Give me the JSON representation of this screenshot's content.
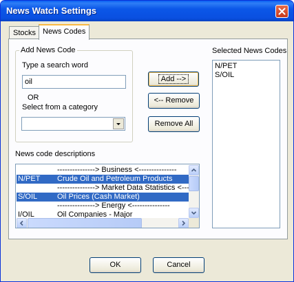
{
  "window": {
    "title": "News Watch Settings"
  },
  "tabs": [
    {
      "label": "Stocks"
    },
    {
      "label": "News Codes"
    }
  ],
  "add_group": {
    "legend": "Add News Code",
    "search_label": "Type a search word",
    "search_value": "oil",
    "or_label": "OR",
    "category_label": "Select from a category",
    "category_value": ""
  },
  "buttons": {
    "add": "Add -->",
    "remove": "<-- Remove",
    "remove_all": "Remove All",
    "ok": "OK",
    "cancel": "Cancel"
  },
  "descriptions": {
    "label": "News code descriptions",
    "rows": [
      {
        "code": "",
        "text": "---------------> Business <---------------",
        "selected": false
      },
      {
        "code": "N/PET",
        "text": "Crude Oil and Petroleum Products",
        "selected": true
      },
      {
        "code": "",
        "text": "---------------> Market Data Statistics <------",
        "selected": false
      },
      {
        "code": "S/OIL",
        "text": "Oil Prices (Cash Market)",
        "selected": true
      },
      {
        "code": "",
        "text": "---------------> Energy <---------------",
        "selected": false
      },
      {
        "code": "I/OIL",
        "text": "Oil Companies - Major",
        "selected": false
      }
    ]
  },
  "selected_codes": {
    "label": "Selected News Codes",
    "items": [
      "N/PET",
      "S/OIL"
    ]
  }
}
